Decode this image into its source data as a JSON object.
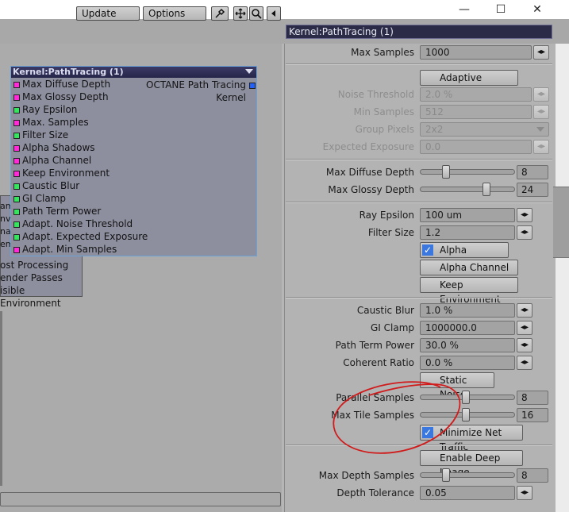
{
  "window": {
    "minimize_glyph": "—",
    "maximize_glyph": "☐",
    "close_glyph": "✕"
  },
  "toolbar": {
    "update_label": "Update",
    "options_label": "Options",
    "panel_header": "Kernel:PathTracing (1)"
  },
  "node": {
    "title": "Kernel:PathTracing (1)",
    "output_label": "OCTANE Path Tracing Kernel",
    "inputs": [
      {
        "label": "Max Diffuse Depth",
        "color": "magenta"
      },
      {
        "label": "Max Glossy Depth",
        "color": "magenta"
      },
      {
        "label": "Ray Epsilon",
        "color": "green"
      },
      {
        "label": "Max. Samples",
        "color": "magenta"
      },
      {
        "label": "Filter Size",
        "color": "green"
      },
      {
        "label": "Alpha Shadows",
        "color": "magenta"
      },
      {
        "label": "Alpha Channel",
        "color": "magenta"
      },
      {
        "label": "Keep Environment",
        "color": "magenta"
      },
      {
        "label": "Caustic Blur",
        "color": "green"
      },
      {
        "label": "GI Clamp",
        "color": "green"
      },
      {
        "label": "Path Term Power",
        "color": "green"
      },
      {
        "label": "Adapt. Noise Threshold",
        "color": "green"
      },
      {
        "label": "Adapt. Expected Exposure",
        "color": "green"
      },
      {
        "label": "Adapt. Min Samples",
        "color": "magenta"
      }
    ]
  },
  "back_node": {
    "partial_rows": [
      "ame",
      "nvi",
      "nag",
      "em"
    ],
    "rows": [
      "ost Processing",
      "ender Passes",
      "isible Environment"
    ]
  },
  "panel": {
    "max_samples": {
      "label": "Max Samples",
      "value": "1000"
    },
    "adaptive_sampling": {
      "label": "Adaptive Sampling"
    },
    "noise_threshold": {
      "label": "Noise Threshold",
      "value": "2.0 %"
    },
    "min_samples": {
      "label": "Min Samples",
      "value": "512"
    },
    "group_pixels": {
      "label": "Group Pixels",
      "value": "2x2"
    },
    "expected_exposure": {
      "label": "Expected Exposure",
      "value": "0.0"
    },
    "max_diffuse_depth": {
      "label": "Max Diffuse Depth",
      "value": "8",
      "level": 0.25
    },
    "max_glossy_depth": {
      "label": "Max Glossy Depth",
      "value": "24",
      "level": 0.72
    },
    "ray_epsilon": {
      "label": "Ray Epsilon",
      "value": "100 um"
    },
    "filter_size": {
      "label": "Filter Size",
      "value": "1.2"
    },
    "alpha_shadows": {
      "label": "Alpha Shadows",
      "checked": true
    },
    "alpha_channel": {
      "label": "Alpha Channel",
      "checked": false
    },
    "keep_environment": {
      "label": "Keep Environment",
      "checked": false
    },
    "caustic_blur": {
      "label": "Caustic Blur",
      "value": "1.0 %"
    },
    "gi_clamp": {
      "label": "GI Clamp",
      "value": "1000000.0"
    },
    "path_term_power": {
      "label": "Path Term Power",
      "value": "30.0 %"
    },
    "coherent_ratio": {
      "label": "Coherent Ratio",
      "value": "0.0 %"
    },
    "static_noise": {
      "label": "Static Noise",
      "checked": false
    },
    "parallel_samples": {
      "label": "Parallel Samples",
      "value": "8",
      "level": 0.48
    },
    "max_tile_samples": {
      "label": "Max Tile Samples",
      "value": "16",
      "level": 0.48
    },
    "minimize_net_traffic": {
      "label": "Minimize Net Traffic",
      "checked": true
    },
    "enable_deep_image": {
      "label": "Enable Deep Image",
      "checked": false
    },
    "max_depth_samples": {
      "label": "Max Depth Samples",
      "value": "8",
      "level": 0.25
    },
    "depth_tolerance": {
      "label": "Depth Tolerance",
      "value": "0.05"
    }
  },
  "annotation": {
    "color": "#d01c1c"
  },
  "colors": {
    "node_border": "#6aa1d6",
    "checkbox_on": "#3a78e0",
    "header_bg": "#2b2b47"
  }
}
